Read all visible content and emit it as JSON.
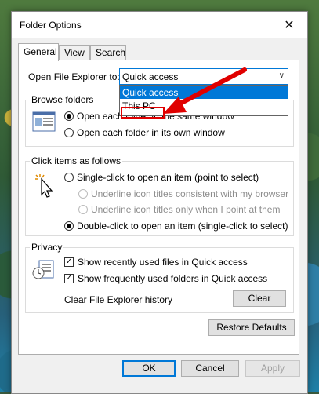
{
  "window": {
    "title": "Folder Options"
  },
  "tabs": [
    {
      "label": "General"
    },
    {
      "label": "View"
    },
    {
      "label": "Search"
    }
  ],
  "open_explorer": {
    "label": "Open File Explorer to:",
    "selected": "Quick access",
    "options": [
      "Quick access",
      "This PC"
    ]
  },
  "browse_folders": {
    "title": "Browse folders",
    "opt1": "Open each folder in the same window",
    "opt2": "Open each folder in its own window"
  },
  "click_items": {
    "title": "Click items as follows",
    "single": "Single-click to open an item (point to select)",
    "underline1": "Underline icon titles consistent with my browser",
    "underline2": "Underline icon titles only when I point at them",
    "double": "Double-click to open an item (single-click to select)"
  },
  "privacy": {
    "title": "Privacy",
    "recent": "Show recently used files in Quick access",
    "frequent": "Show frequently used folders in Quick access",
    "clear_label": "Clear File Explorer history",
    "clear_button": "Clear"
  },
  "buttons": {
    "restore": "Restore Defaults",
    "ok": "OK",
    "cancel": "Cancel",
    "apply": "Apply"
  },
  "colors": {
    "accent": "#0078d7",
    "annotation": "#e00000"
  }
}
